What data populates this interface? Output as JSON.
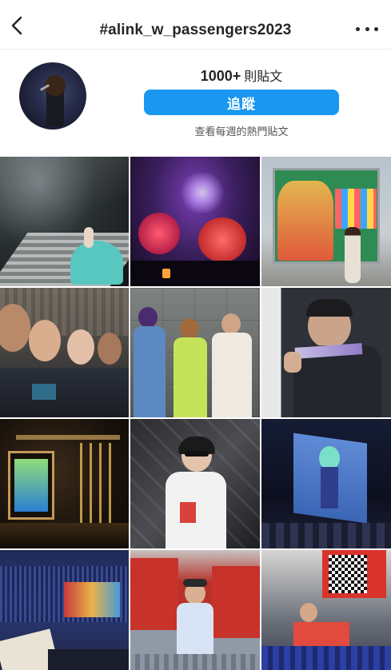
{
  "header": {
    "title": "#alink_w_passengers2023"
  },
  "profile": {
    "post_count": "1000+",
    "post_unit": "則貼文",
    "follow_label": "追蹤",
    "weekly_link": "查看每週的熱門貼文"
  },
  "colors": {
    "follow_button": "#1a97f0",
    "text": "#262626"
  },
  "icons": {
    "back": "chevron-left-icon",
    "more": "more-horizontal-icon"
  },
  "grid": {
    "tile_count": 12
  }
}
